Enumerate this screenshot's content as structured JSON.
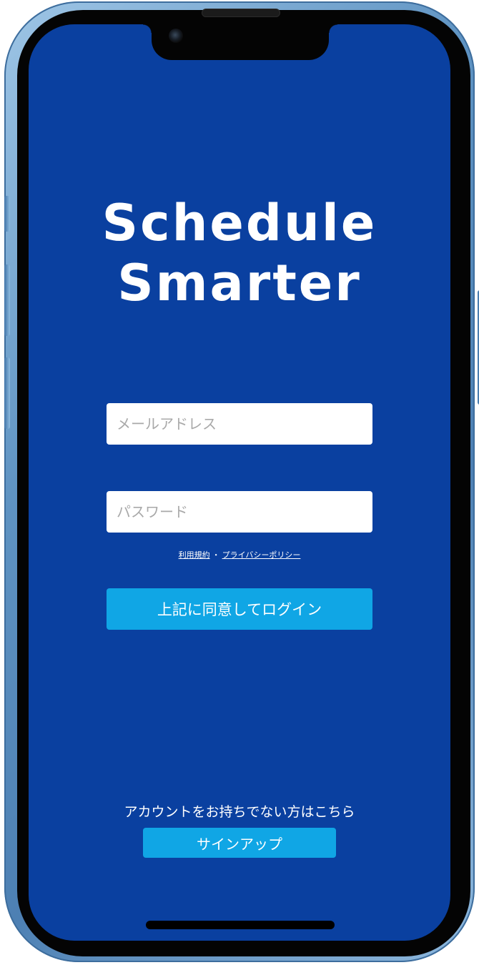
{
  "app": {
    "title_line1": "Schedule",
    "title_line2": "Smarter"
  },
  "form": {
    "email_placeholder": "メールアドレス",
    "email_value": "",
    "password_placeholder": "パスワード",
    "password_value": "",
    "terms_label": "利用規約",
    "separator": "・",
    "privacy_label": "プライバシーポリシー",
    "login_label": "上記に同意してログイン"
  },
  "signup": {
    "prompt": "アカウントをお持ちでない方はこちら",
    "button_label": "サインアップ"
  },
  "colors": {
    "background": "#0a40a0",
    "accent": "#10a6e5",
    "device_frame": "#5f93c2",
    "text": "#ffffff"
  }
}
